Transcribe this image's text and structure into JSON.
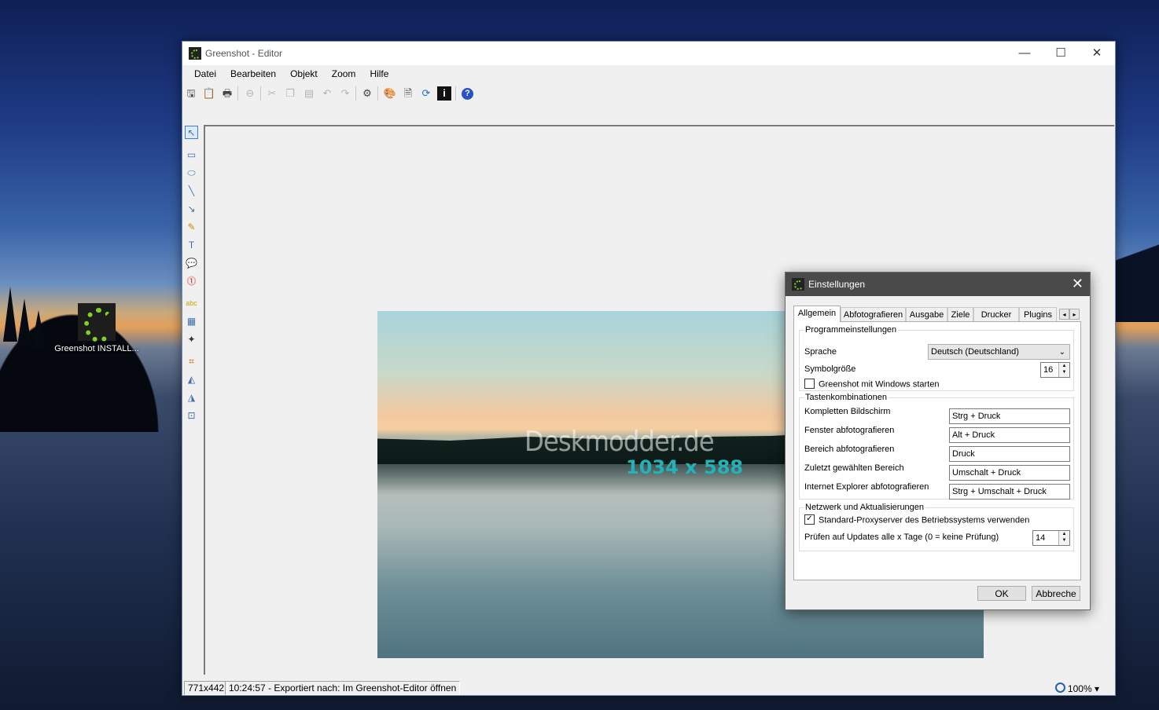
{
  "desktop": {
    "icon_label": "Greenshot INSTALL..."
  },
  "window": {
    "title": "Greenshot - Editor",
    "minimize_glyph": "—",
    "maximize_glyph": "☐",
    "close_glyph": "✕"
  },
  "menu": [
    "Datei",
    "Bearbeiten",
    "Objekt",
    "Zoom",
    "Hilfe"
  ],
  "toolbar": {
    "icons": [
      "save-icon",
      "clipboard-icon",
      "print-icon",
      "delete-icon",
      "cut-icon",
      "copy-icon",
      "paste-icon",
      "undo-icon",
      "redo-icon",
      "settings-icon",
      "image-editor-icon",
      "document-icon",
      "refresh-icon",
      "info-icon",
      "help-icon"
    ]
  },
  "tools": {
    "icons": [
      "pointer-icon",
      "rectangle-icon",
      "ellipse-icon",
      "line-icon",
      "arrow-icon",
      "freehand-icon",
      "text-icon",
      "speechbubble-icon",
      "counter-icon",
      "highlight-icon",
      "obfuscate-icon",
      "effects-icon",
      "crop-icon",
      "rotate-left-icon",
      "rotate-right-icon",
      "resize-icon"
    ]
  },
  "canvas": {
    "watermark": "Deskmodder.de",
    "dimensions_label": "1034 x 588"
  },
  "status": {
    "size": "771x442",
    "message": "10:24:57 - Exportiert nach: Im Greenshot-Editor öffnen",
    "zoom": "100%",
    "zoom_arrow": "▾"
  },
  "dialog": {
    "title": "Einstellungen",
    "close_glyph": "✕",
    "tabs": [
      "Allgemein",
      "Abfotografieren",
      "Ausgabe",
      "Ziele",
      "Drucker",
      "Plugins"
    ],
    "active_tab": "Allgemein",
    "tab_prev": "◂",
    "tab_next": "▸",
    "program_group": {
      "legend": "Programmeinstellungen",
      "language_label": "Sprache",
      "language_value": "Deutsch (Deutschland)",
      "icon_size_label": "Symbolgröße",
      "icon_size_value": "16",
      "autostart_label": "Greenshot mit Windows starten",
      "autostart_checked": false
    },
    "hotkeys_group": {
      "legend": "Tastenkombinationen",
      "rows": [
        {
          "label": "Kompletten Bildschirm",
          "value": "Strg + Druck"
        },
        {
          "label": "Fenster abfotografieren",
          "value": "Alt + Druck"
        },
        {
          "label": "Bereich abfotografieren",
          "value": "Druck"
        },
        {
          "label": "Zuletzt gewählten Bereich",
          "value": "Umschalt + Druck"
        },
        {
          "label": "Internet Explorer abfotografieren",
          "value": "Strg + Umschalt + Druck"
        }
      ]
    },
    "network_group": {
      "legend": "Netzwerk und Aktualisierungen",
      "proxy_label": "Standard-Proxyserver des Betriebssystems verwenden",
      "proxy_checked": true,
      "check_mark": "✓",
      "updates_label": "Prüfen auf Updates alle x Tage (0 = keine Prüfung)",
      "updates_value": "14"
    },
    "ok_label": "OK",
    "cancel_label": "Abbreche"
  }
}
